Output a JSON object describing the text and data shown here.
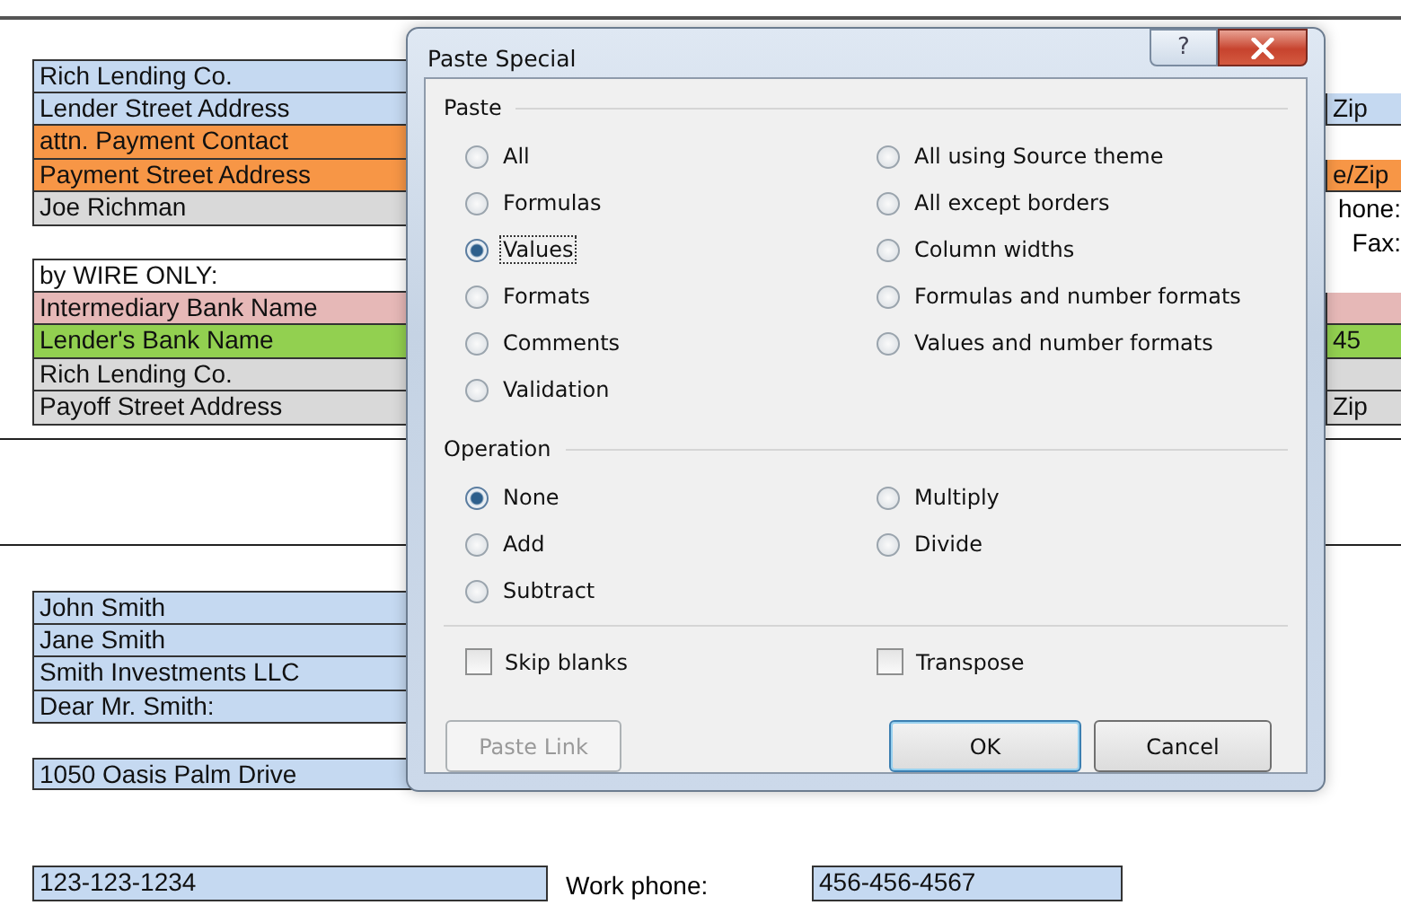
{
  "sheet": {
    "left_column": [
      {
        "kind": "cell",
        "text": "Rich Lending Co.",
        "color": "#c5d9f1"
      },
      {
        "kind": "cell",
        "text": "Lender Street Address",
        "color": "#c5d9f1"
      },
      {
        "kind": "cell",
        "text": "attn. Payment Contact",
        "color": "#f79646"
      },
      {
        "kind": "cell",
        "text": "Payment Street Address",
        "color": "#f79646"
      },
      {
        "kind": "cell",
        "text": "Joe Richman",
        "color": "#d9d9d9"
      },
      {
        "kind": "gap"
      },
      {
        "kind": "cell",
        "text": "by WIRE ONLY:",
        "color": "#ffffff"
      },
      {
        "kind": "cell",
        "text": "Intermediary Bank Name",
        "color": "#e6b8b7"
      },
      {
        "kind": "cell",
        "text": "Lender's Bank Name",
        "color": "#92d050"
      },
      {
        "kind": "cell",
        "text": "Rich Lending Co.",
        "color": "#d9d9d9"
      },
      {
        "kind": "cell",
        "text": "Payoff Street Address",
        "color": "#d9d9d9"
      },
      {
        "kind": "gap"
      },
      {
        "kind": "gap"
      },
      {
        "kind": "gap"
      },
      {
        "kind": "gap"
      },
      {
        "kind": "gap"
      },
      {
        "kind": "cell",
        "text": "John Smith",
        "color": "#c5d9f1"
      },
      {
        "kind": "cell",
        "text": "Jane Smith",
        "color": "#c5d9f1"
      },
      {
        "kind": "cell",
        "text": "Smith Investments LLC",
        "color": "#c5d9f1"
      },
      {
        "kind": "cell",
        "text": "Dear Mr. Smith:",
        "color": "#c5d9f1"
      },
      {
        "kind": "gap"
      },
      {
        "kind": "cell",
        "text": "1050 Oasis Palm Drive",
        "color": "#c5d9f1"
      }
    ],
    "right_column": [
      {
        "kind": "gap"
      },
      {
        "kind": "cell",
        "text": "Zip",
        "color": "#c5d9f1"
      },
      {
        "kind": "gap"
      },
      {
        "kind": "cell",
        "text": "e/Zip",
        "color": "#f79646"
      },
      {
        "kind": "label",
        "text": "hone:"
      },
      {
        "kind": "label",
        "text": "Fax:"
      },
      {
        "kind": "gap"
      },
      {
        "kind": "cell",
        "color": "#e6b8b7"
      },
      {
        "kind": "cell",
        "text": "45",
        "color": "#92d050"
      },
      {
        "kind": "cell",
        "color": "#d9d9d9"
      },
      {
        "kind": "cell",
        "text": "Zip",
        "color": "#d9d9d9"
      }
    ],
    "bottom_row": [
      {
        "kind": "cell",
        "text": "123-123-1234",
        "color": "#c5d9f1"
      },
      {
        "kind": "label",
        "text": "Work phone:"
      },
      {
        "kind": "cell",
        "text": "456-456-4567",
        "color": "#c5d9f1"
      }
    ]
  },
  "dialog": {
    "title": "Paste Special",
    "help_button": "?",
    "paste": {
      "heading": "Paste",
      "options": [
        {
          "label": "All",
          "selected": false,
          "focused": false
        },
        {
          "label": "Formulas",
          "selected": false,
          "focused": false
        },
        {
          "label": "Values",
          "selected": true,
          "focused": true
        },
        {
          "label": "Formats",
          "selected": false,
          "focused": false
        },
        {
          "label": "Comments",
          "selected": false,
          "focused": false
        },
        {
          "label": "Validation",
          "selected": false,
          "focused": false
        },
        {
          "label": "All using Source theme",
          "selected": false,
          "focused": false
        },
        {
          "label": "All except borders",
          "selected": false,
          "focused": false
        },
        {
          "label": "Column widths",
          "selected": false,
          "focused": false
        },
        {
          "label": "Formulas and number formats",
          "selected": false,
          "focused": false
        },
        {
          "label": "Values and number formats",
          "selected": false,
          "focused": false
        }
      ]
    },
    "operation": {
      "heading": "Operation",
      "options": [
        {
          "label": "None",
          "selected": true,
          "focused": false
        },
        {
          "label": "Add",
          "selected": false,
          "focused": false
        },
        {
          "label": "Subtract",
          "selected": false,
          "focused": false
        },
        {
          "label": "Multiply",
          "selected": false,
          "focused": false
        },
        {
          "label": "Divide",
          "selected": false,
          "focused": false
        }
      ]
    },
    "checkboxes": [
      {
        "label": "Skip blanks",
        "checked": false
      },
      {
        "label": "Transpose",
        "checked": false
      }
    ],
    "buttons": [
      {
        "label": "Paste Link",
        "disabled": true,
        "default": false
      },
      {
        "label": "OK",
        "disabled": false,
        "default": true
      },
      {
        "label": "Cancel",
        "disabled": false,
        "default": false
      }
    ]
  }
}
